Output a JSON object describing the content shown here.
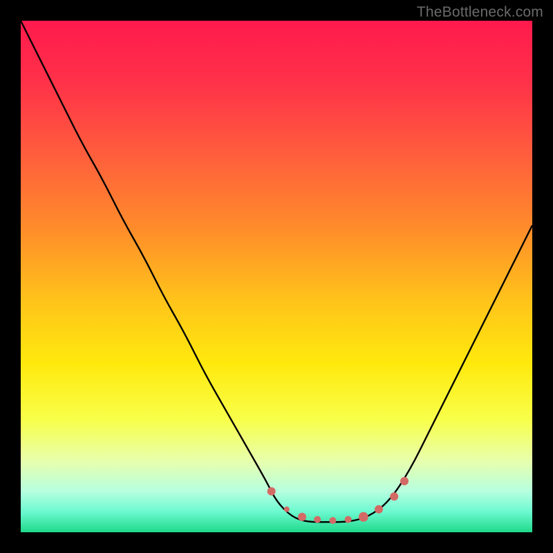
{
  "watermark": "TheBottleneck.com",
  "colors": {
    "bg": "#000000",
    "gradient_stops": [
      {
        "offset": 0.0,
        "color": "#ff1a4d"
      },
      {
        "offset": 0.12,
        "color": "#ff3149"
      },
      {
        "offset": 0.25,
        "color": "#ff5a3e"
      },
      {
        "offset": 0.4,
        "color": "#ff8a2b"
      },
      {
        "offset": 0.55,
        "color": "#ffc41a"
      },
      {
        "offset": 0.67,
        "color": "#ffe90d"
      },
      {
        "offset": 0.78,
        "color": "#f8ff4a"
      },
      {
        "offset": 0.86,
        "color": "#e8ffac"
      },
      {
        "offset": 0.92,
        "color": "#b6ffe0"
      },
      {
        "offset": 0.96,
        "color": "#6cf9d0"
      },
      {
        "offset": 1.0,
        "color": "#1fd98a"
      }
    ],
    "line": "#000000",
    "marker": "#d46a66"
  },
  "chart_data": {
    "type": "line",
    "title": "",
    "xlabel": "",
    "ylabel": "",
    "xlim": [
      0,
      100
    ],
    "ylim": [
      0,
      100
    ],
    "series": [
      {
        "name": "bottleneck-curve",
        "x": [
          0,
          4,
          8,
          12,
          16,
          20,
          24,
          28,
          32,
          36,
          40,
          44,
          48,
          50,
          53,
          56,
          60,
          64,
          68,
          72,
          76,
          80,
          84,
          88,
          92,
          96,
          100
        ],
        "y": [
          100,
          92,
          84,
          76,
          69,
          61,
          54,
          46,
          39,
          31,
          24,
          17,
          10,
          6,
          3,
          2,
          2,
          2,
          3,
          6,
          12,
          20,
          28,
          36,
          44,
          52,
          60
        ]
      }
    ],
    "markers": {
      "name": "highlight-band",
      "points": [
        {
          "x": 49,
          "y": 8,
          "r": 6
        },
        {
          "x": 52,
          "y": 4.5,
          "r": 4
        },
        {
          "x": 55,
          "y": 3,
          "r": 6
        },
        {
          "x": 58,
          "y": 2.5,
          "r": 5
        },
        {
          "x": 61,
          "y": 2.3,
          "r": 5
        },
        {
          "x": 64,
          "y": 2.5,
          "r": 5
        },
        {
          "x": 67,
          "y": 3,
          "r": 7
        },
        {
          "x": 70,
          "y": 4.5,
          "r": 6
        },
        {
          "x": 73,
          "y": 7,
          "r": 6
        },
        {
          "x": 75,
          "y": 10,
          "r": 6
        }
      ]
    }
  }
}
